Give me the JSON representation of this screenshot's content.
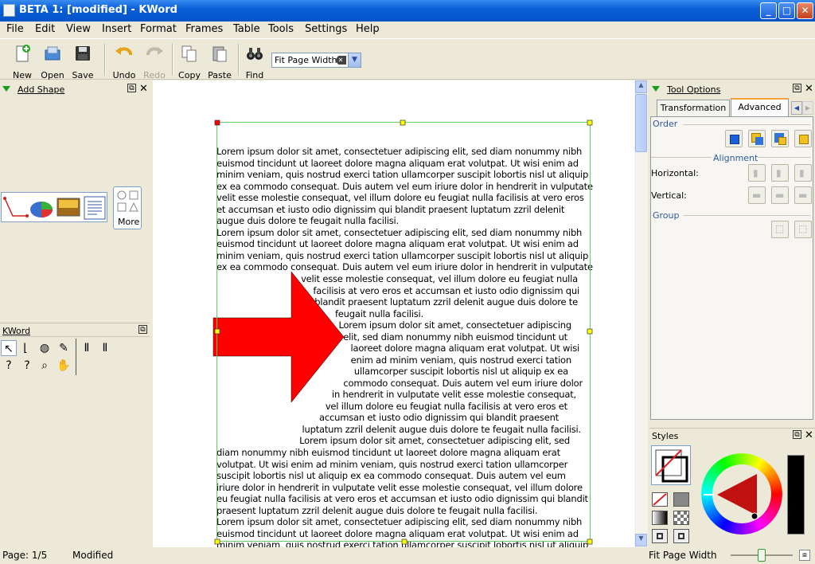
{
  "window": {
    "title": "BETA 1:  [modified] - KWord",
    "min_label": "_",
    "max_label": "□",
    "close_label": "✕"
  },
  "menu": [
    "File",
    "Edit",
    "View",
    "Insert",
    "Format",
    "Frames",
    "Table",
    "Tools",
    "Settings",
    "Help"
  ],
  "toolbar": {
    "new": "New",
    "open": "Open",
    "save": "Save",
    "undo": "Undo",
    "redo": "Redo",
    "copy": "Copy",
    "paste": "Paste",
    "find": "Find",
    "zoom_value": "Fit Page Width"
  },
  "dock_add_shape": {
    "title": "Add Shape",
    "more": "More"
  },
  "dock_kword": {
    "title": "KWord"
  },
  "tool_options": {
    "title": "Tool Options",
    "tabs": [
      "Transformation",
      "Advanced"
    ],
    "active_tab": "Advanced",
    "order_label": "Order",
    "alignment_label": "Alignment",
    "horizontal_label": "Horizontal:",
    "vertical_label": "Vertical:",
    "group_label": "Group"
  },
  "styles": {
    "title": "Styles"
  },
  "document": {
    "top_lines": [
      "Lorem ipsum dolor sit amet, consectetuer adipiscing elit, sed diam nonummy nibh",
      "euismod tincidunt ut laoreet dolore magna aliquam erat volutpat. Ut wisi enim ad",
      "minim veniam, quis nostrud exerci tation ullamcorper suscipit lobortis nisl ut aliquip",
      "ex ea commodo consequat. Duis autem vel eum iriure dolor in hendrerit in vulputate",
      "velit esse molestie consequat, vel illum dolore eu feugiat nulla facilisis at vero eros",
      "et accumsan et iusto odio dignissim qui blandit praesent luptatum zzril delenit",
      "augue duis dolore te feugait nulla facilisi.",
      "Lorem ipsum dolor sit amet, consectetuer adipiscing elit, sed diam nonummy nibh",
      "euismod tincidunt ut laoreet dolore magna aliquam erat volutpat. Ut wisi enim ad",
      "minim veniam, quis nostrud exerci tation ullamcorper suscipit lobortis nisl ut aliquip",
      "ex ea commodo consequat. Duis autem vel eum iriure dolor in hendrerit in vulputate"
    ],
    "wrap_lines": [
      "velit esse molestie consequat, vel illum dolore eu feugiat nulla",
      "facilisis at vero eros et accumsan et iusto odio dignissim qui",
      "blandit praesent luptatum zzril delenit augue duis dolore te",
      "feugait nulla facilisi.",
      "Lorem ipsum dolor sit amet, consectetuer adipiscing",
      "elit, sed diam nonummy nibh euismod tincidunt ut",
      "laoreet dolore magna aliquam erat volutpat. Ut wisi",
      "enim ad minim veniam, quis nostrud exerci tation",
      "ullamcorper suscipit lobortis nisl ut aliquip ex ea",
      "commodo consequat. Duis autem vel eum iriure dolor",
      "in hendrerit in vulputate velit esse molestie consequat,",
      "vel illum dolore eu feugiat nulla facilisis at vero eros et",
      "accumsan et iusto odio dignissim qui blandit praesent",
      "luptatum zzril delenit augue duis dolore te feugait nulla facilisi.",
      "Lorem ipsum dolor sit amet, consectetuer adipiscing elit, sed"
    ],
    "bottom_lines": [
      "diam nonummy nibh euismod tincidunt ut laoreet dolore magna aliquam erat",
      "volutpat. Ut wisi enim ad minim veniam, quis nostrud exerci tation ullamcorper",
      "suscipit lobortis nisl ut aliquip ex ea commodo consequat. Duis autem vel eum",
      "iriure dolor in hendrerit in vulputate velit esse molestie consequat, vel illum dolore",
      "eu feugiat nulla facilisis at vero eros et accumsan et iusto odio dignissim qui blandit",
      "praesent luptatum zzril delenit augue duis dolore te feugait nulla facilisi.",
      "Lorem ipsum dolor sit amet, consectetuer adipiscing elit, sed diam nonummy nibh",
      "euismod tincidunt ut laoreet dolore magna aliquam erat volutpat. Ut wisi enim ad",
      "minim veniam, quis nostrud exerci tation ullamcorper suscipit lobortis nisl ut aliquip"
    ]
  },
  "statusbar": {
    "page": "Page: 1/5",
    "state": "Modified",
    "zoom": "Fit Page Width"
  },
  "colors": {
    "arrow": "#ff0000",
    "frame_border": "#66cc66",
    "handle": "#ffff00",
    "title_blue": "#0a5fd8"
  }
}
